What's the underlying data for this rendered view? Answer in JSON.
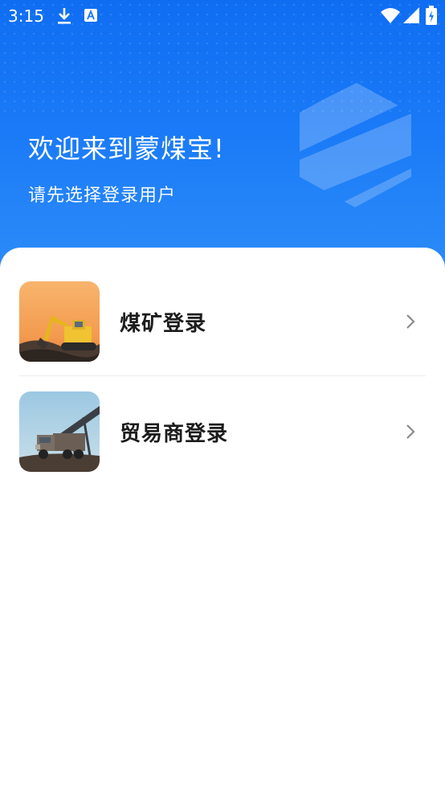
{
  "status_bar": {
    "time": "3:15",
    "icons": [
      "download-icon",
      "a-icon",
      "wifi-icon",
      "signal-icon",
      "battery-icon"
    ]
  },
  "header": {
    "title": "欢迎来到蒙煤宝!",
    "subtitle": "请先选择登录用户",
    "logo_icon": "brand-hexagon-stripes-logo",
    "gradient_colors": [
      "#0f6df2",
      "#2f8ef8"
    ]
  },
  "login_options": [
    {
      "label": "煤矿登录",
      "image": "excavator-photo",
      "icon": "chevron-right-icon"
    },
    {
      "label": "贸易商登录",
      "image": "dump-truck-conveyor-photo",
      "icon": "chevron-right-icon"
    }
  ],
  "colors": {
    "accent": "#1677f5",
    "text_primary": "#1c1c1c",
    "chevron": "#8a8a8a"
  }
}
